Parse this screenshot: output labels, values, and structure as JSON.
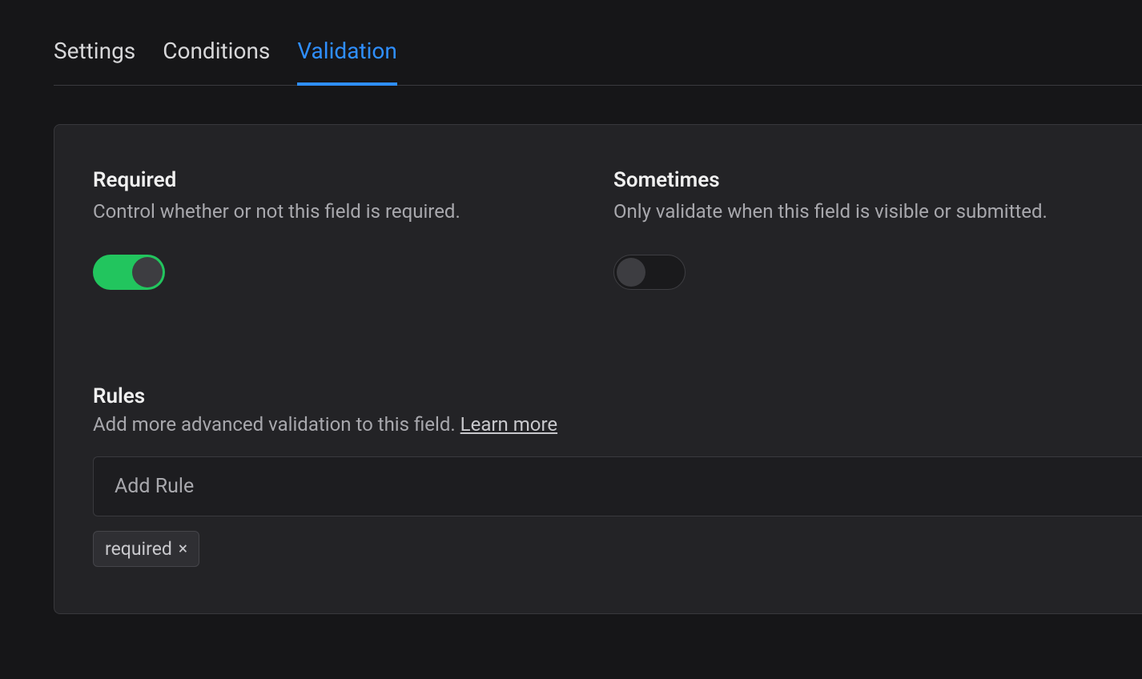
{
  "tabs": {
    "settings": "Settings",
    "conditions": "Conditions",
    "validation": "Validation",
    "active": "validation"
  },
  "required": {
    "title": "Required",
    "desc": "Control whether or not this field is required.",
    "on": true
  },
  "sometimes": {
    "title": "Sometimes",
    "desc": "Only validate when this field is visible or submitted.",
    "on": false
  },
  "rules": {
    "title": "Rules",
    "desc_prefix": "Add more advanced validation to this field. ",
    "learn_more": "Learn more",
    "placeholder": "Add Rule",
    "tags": [
      {
        "label": "required"
      }
    ]
  }
}
